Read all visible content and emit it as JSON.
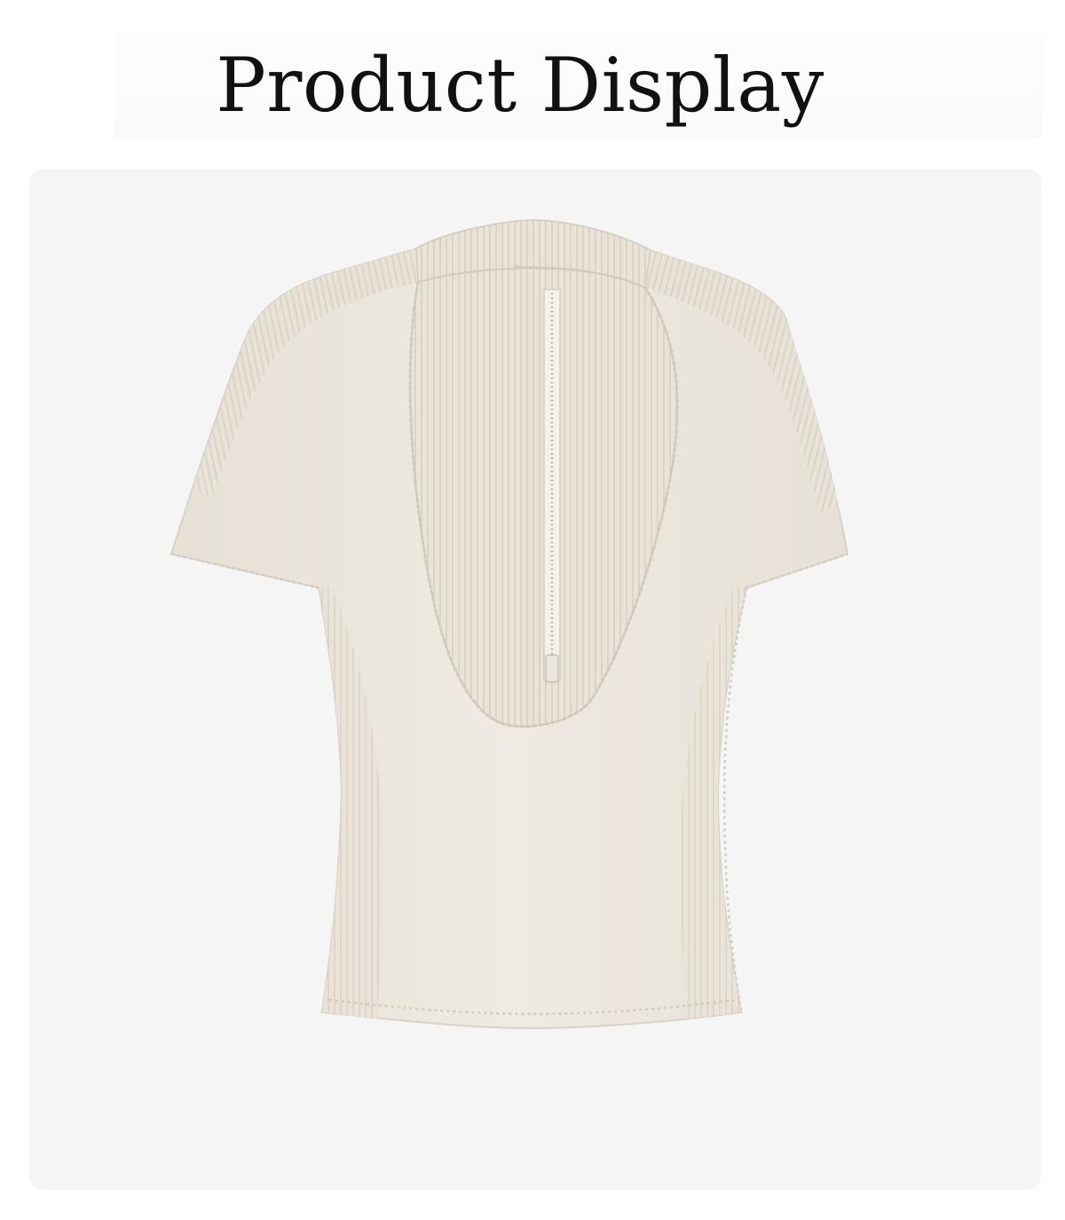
{
  "header": {
    "title": "Product Display"
  },
  "product": {
    "image": "short-sleeve-half-zip-ribbed-top-image",
    "color": "#ece7de"
  },
  "colors": {
    "panel": "#f5f5f5",
    "garment": "#ece7de",
    "rib": "#e2dcd1",
    "stitch": "#d4cdc1",
    "title": "#111111"
  }
}
